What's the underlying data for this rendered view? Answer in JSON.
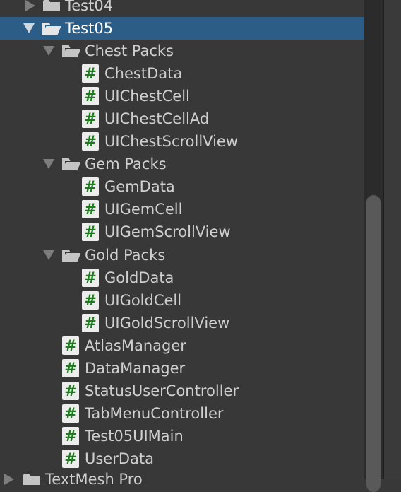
{
  "tree": {
    "items": [
      {
        "label": "Test04",
        "type": "folder",
        "expanded": false,
        "depth": 0,
        "icon": "folder-closed-icon"
      },
      {
        "label": "Test05",
        "type": "folder",
        "expanded": true,
        "depth": 0,
        "selected": true,
        "icon": "folder-open-icon"
      },
      {
        "label": "Chest Packs",
        "type": "folder",
        "expanded": true,
        "depth": 1,
        "icon": "folder-open-icon"
      },
      {
        "label": "ChestData",
        "type": "script",
        "depth": 2,
        "icon": "csharp-script-icon"
      },
      {
        "label": "UIChestCell",
        "type": "script",
        "depth": 2,
        "icon": "csharp-script-icon"
      },
      {
        "label": "UIChestCellAd",
        "type": "script",
        "depth": 2,
        "icon": "csharp-script-icon"
      },
      {
        "label": "UIChestScrollView",
        "type": "script",
        "depth": 2,
        "icon": "csharp-script-icon"
      },
      {
        "label": "Gem Packs",
        "type": "folder",
        "expanded": true,
        "depth": 1,
        "icon": "folder-open-icon"
      },
      {
        "label": "GemData",
        "type": "script",
        "depth": 2,
        "icon": "csharp-script-icon"
      },
      {
        "label": "UIGemCell",
        "type": "script",
        "depth": 2,
        "icon": "csharp-script-icon"
      },
      {
        "label": "UIGemScrollView",
        "type": "script",
        "depth": 2,
        "icon": "csharp-script-icon"
      },
      {
        "label": "Gold Packs",
        "type": "folder",
        "expanded": true,
        "depth": 1,
        "icon": "folder-open-icon"
      },
      {
        "label": "GoldData",
        "type": "script",
        "depth": 2,
        "icon": "csharp-script-icon"
      },
      {
        "label": "UIGoldCell",
        "type": "script",
        "depth": 2,
        "icon": "csharp-script-icon"
      },
      {
        "label": "UIGoldScrollView",
        "type": "script",
        "depth": 2,
        "icon": "csharp-script-icon"
      },
      {
        "label": "AtlasManager",
        "type": "script",
        "depth": 1,
        "icon": "csharp-script-icon"
      },
      {
        "label": "DataManager",
        "type": "script",
        "depth": 1,
        "icon": "csharp-script-icon"
      },
      {
        "label": "StatusUserController",
        "type": "script",
        "depth": 1,
        "icon": "csharp-script-icon"
      },
      {
        "label": "TabMenuController",
        "type": "script",
        "depth": 1,
        "icon": "csharp-script-icon"
      },
      {
        "label": "Test05UIMain",
        "type": "script",
        "depth": 1,
        "icon": "csharp-script-icon"
      },
      {
        "label": "UserData",
        "type": "script",
        "depth": 1,
        "icon": "csharp-script-icon"
      },
      {
        "label": "TextMesh Pro",
        "type": "folder",
        "expanded": false,
        "depth": -1,
        "icon": "folder-closed-icon"
      }
    ],
    "script_glyph": "#"
  },
  "colors": {
    "background": "#383838",
    "selection": "#2c5d87",
    "script_icon_bg": "#ededed",
    "script_icon_fg": "#1b7d1b",
    "text": "#cfcfcf",
    "scrollbar_thumb": "#595959"
  }
}
